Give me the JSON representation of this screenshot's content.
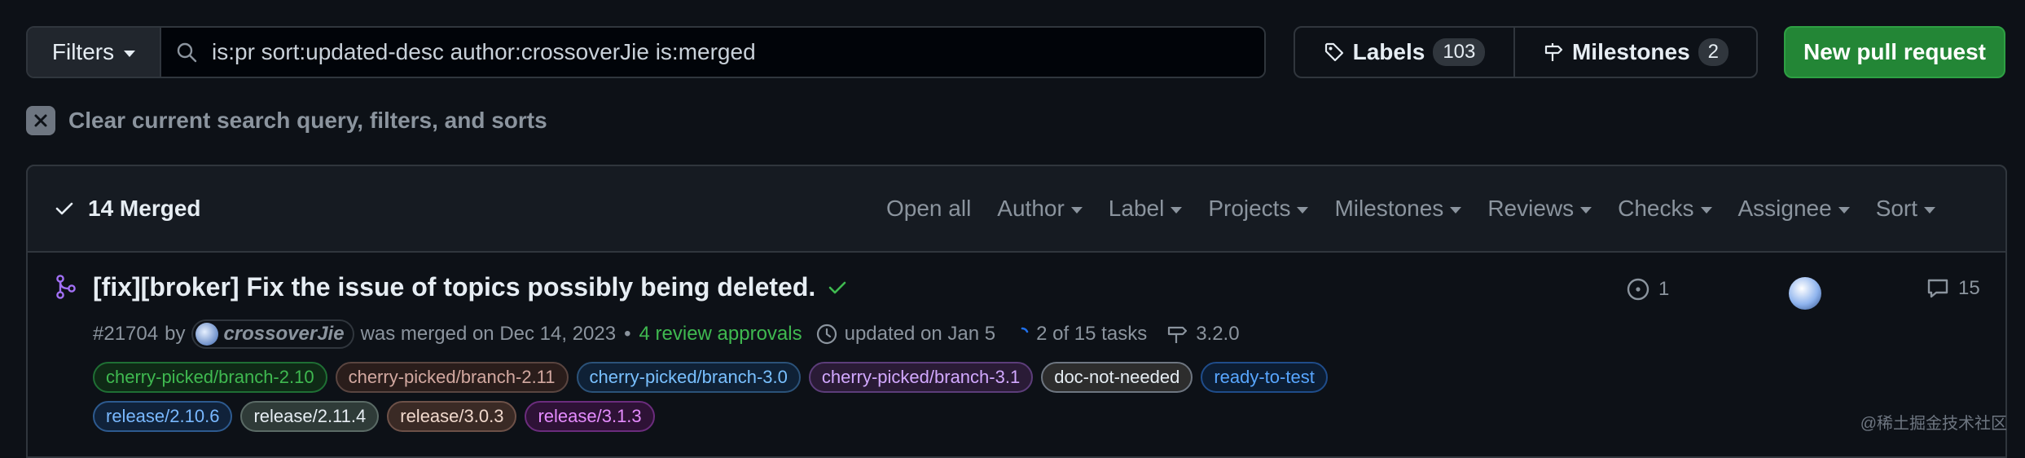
{
  "toolbar_top": {
    "filters_label": "Filters",
    "search_query": "is:pr sort:updated-desc author:crossoverJie is:merged",
    "labels_label": "Labels",
    "labels_count": "103",
    "milestones_label": "Milestones",
    "milestones_count": "2",
    "new_pr_label": "New pull request"
  },
  "clear": {
    "label": "Clear current search query, filters, and sorts"
  },
  "list_header": {
    "merged_label": "14 Merged",
    "open_all": "Open all",
    "filters": [
      "Author",
      "Label",
      "Projects",
      "Milestones",
      "Reviews",
      "Checks",
      "Assignee",
      "Sort"
    ]
  },
  "pr": {
    "title": "[fix][broker] Fix the issue of topics possibly being deleted.",
    "number": "#21704",
    "by": "by",
    "author": "crossoverJie",
    "merged_text": "was merged on Dec 14, 2023",
    "bullet": "•",
    "approvals": "4 review approvals",
    "updated": "updated on Jan 5",
    "tasks": "2 of 15 tasks",
    "milestone": "3.2.0",
    "linked_issues": "1",
    "comments": "15",
    "labels_row1": [
      {
        "text": "cherry-picked/branch-2.10",
        "color": "#3fb950",
        "bg": "#0f2a16",
        "border": "#1f6f34"
      },
      {
        "text": "cherry-picked/branch-2.11",
        "color": "#d2a8a0",
        "bg": "#2a1d1b",
        "border": "#5a4540"
      },
      {
        "text": "cherry-picked/branch-3.0",
        "color": "#79c0ff",
        "bg": "#0f2136",
        "border": "#2b5279"
      },
      {
        "text": "cherry-picked/branch-3.1",
        "color": "#d2a8ff",
        "bg": "#2a1b36",
        "border": "#5c3d7a"
      },
      {
        "text": "doc-not-needed",
        "color": "#e6edf3",
        "bg": "#2d2d2d",
        "border": "#6e7681"
      },
      {
        "text": "ready-to-test",
        "color": "#58a6ff",
        "bg": "#0c1d33",
        "border": "#1f4c8a"
      }
    ],
    "labels_row2": [
      {
        "text": "release/2.10.6",
        "color": "#79b8ff",
        "bg": "#10223a",
        "border": "#2d5a8f"
      },
      {
        "text": "release/2.11.4",
        "color": "#e6edf3",
        "bg": "#2f3b38",
        "border": "#5b6b66"
      },
      {
        "text": "release/3.0.3",
        "color": "#f0d8cc",
        "bg": "#3a2a25",
        "border": "#6d5148"
      },
      {
        "text": "release/3.1.3",
        "color": "#e58cff",
        "bg": "#2e1236",
        "border": "#6b2c7d"
      }
    ]
  },
  "watermark": "@稀土掘金技术社区"
}
